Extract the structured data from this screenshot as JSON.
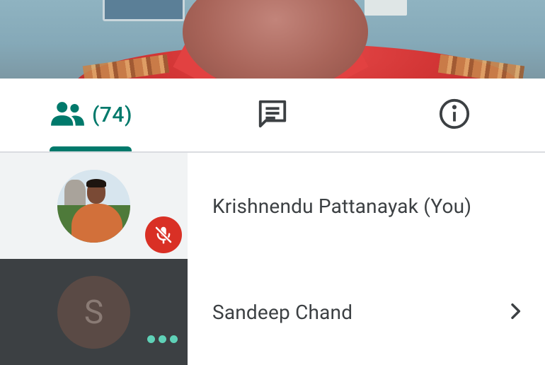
{
  "video": {
    "description": "participant-video"
  },
  "tabs": {
    "people": {
      "icon": "people-icon",
      "count": "(74)",
      "active": true
    },
    "chat": {
      "icon": "chat-icon"
    },
    "info": {
      "icon": "info-icon"
    },
    "accent_color": "#00796b"
  },
  "participants": [
    {
      "name": "Krishnendu Pattanayak (You)",
      "avatar": "photo",
      "muted": true,
      "badge_icon": "mic-off-icon"
    },
    {
      "name": "Sandeep Chand",
      "avatar_letter": "S",
      "speaking": true,
      "chevron_icon": "chevron-right-icon"
    }
  ],
  "colors": {
    "mute_red": "#d93025",
    "speaking_teal": "#5fd1b7",
    "dark_tile": "#3c4043",
    "light_tile": "#f1f3f4"
  }
}
